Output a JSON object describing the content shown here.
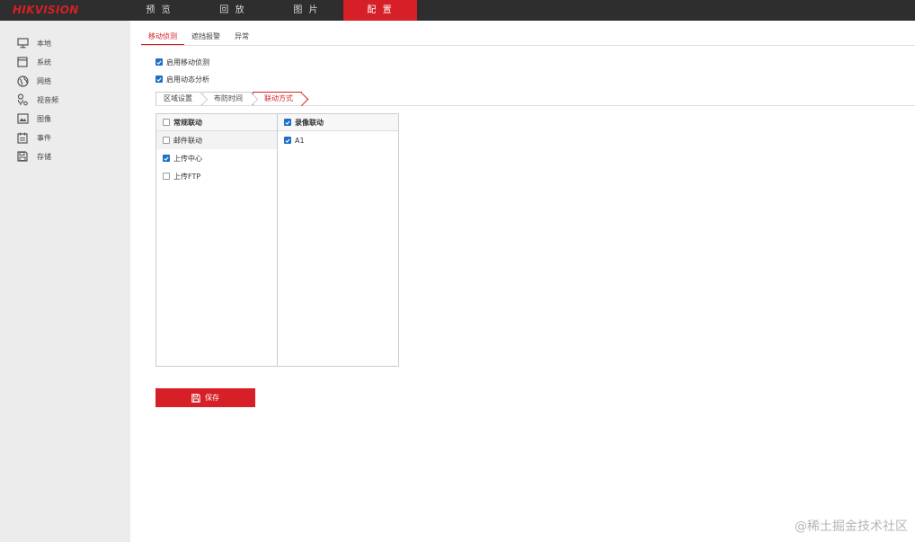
{
  "brand": {
    "logo_text": "HIKVISION",
    "accent_color": "#d61f26"
  },
  "nav": {
    "items": [
      "预 览",
      "回 放",
      "图 片",
      "配 置"
    ],
    "active_index": 3
  },
  "sidebar": {
    "items": [
      {
        "label": "本地",
        "icon": "monitor-icon"
      },
      {
        "label": "系统",
        "icon": "window-icon"
      },
      {
        "label": "网络",
        "icon": "globe-icon"
      },
      {
        "label": "视音频",
        "icon": "microphone-icon"
      },
      {
        "label": "图像",
        "icon": "image-icon"
      },
      {
        "label": "事件",
        "icon": "calendar-icon"
      },
      {
        "label": "存储",
        "icon": "floppy-disk-icon"
      }
    ]
  },
  "subtabs": {
    "items": [
      "移动侦测",
      "遮挡报警",
      "异常"
    ],
    "active_index": 0
  },
  "options": {
    "enable_motion": {
      "label": "启用移动侦测",
      "checked": true
    },
    "enable_dynamic": {
      "label": "启用动态分析",
      "checked": true
    }
  },
  "steps": {
    "items": [
      "区域设置",
      "布防时间",
      "联动方式"
    ],
    "active_index": 2
  },
  "linkage": {
    "normal": {
      "header": "常规联动",
      "header_checked": false,
      "rows": [
        {
          "label": "邮件联动",
          "checked": false
        },
        {
          "label": "上传中心",
          "checked": true
        },
        {
          "label": "上传FTP",
          "checked": false
        }
      ]
    },
    "record": {
      "header": "录像联动",
      "header_checked": true,
      "rows": [
        {
          "label": "A1",
          "checked": true
        }
      ]
    }
  },
  "save_label": "保存",
  "watermark": "@稀土掘金技术社区"
}
